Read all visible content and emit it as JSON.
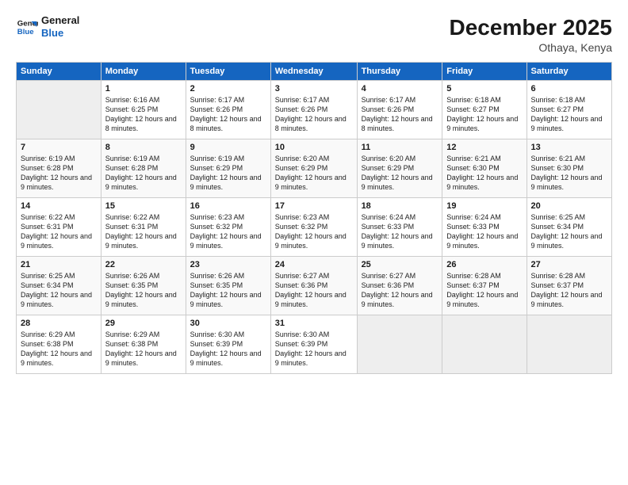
{
  "header": {
    "logo_line1": "General",
    "logo_line2": "Blue",
    "month_title": "December 2025",
    "location": "Othaya, Kenya"
  },
  "days_of_week": [
    "Sunday",
    "Monday",
    "Tuesday",
    "Wednesday",
    "Thursday",
    "Friday",
    "Saturday"
  ],
  "weeks": [
    [
      {
        "day": "",
        "sunrise": "",
        "sunset": "",
        "daylight": "",
        "empty": true
      },
      {
        "day": "1",
        "sunrise": "Sunrise: 6:16 AM",
        "sunset": "Sunset: 6:25 PM",
        "daylight": "Daylight: 12 hours and 8 minutes."
      },
      {
        "day": "2",
        "sunrise": "Sunrise: 6:17 AM",
        "sunset": "Sunset: 6:26 PM",
        "daylight": "Daylight: 12 hours and 8 minutes."
      },
      {
        "day": "3",
        "sunrise": "Sunrise: 6:17 AM",
        "sunset": "Sunset: 6:26 PM",
        "daylight": "Daylight: 12 hours and 8 minutes."
      },
      {
        "day": "4",
        "sunrise": "Sunrise: 6:17 AM",
        "sunset": "Sunset: 6:26 PM",
        "daylight": "Daylight: 12 hours and 8 minutes."
      },
      {
        "day": "5",
        "sunrise": "Sunrise: 6:18 AM",
        "sunset": "Sunset: 6:27 PM",
        "daylight": "Daylight: 12 hours and 9 minutes."
      },
      {
        "day": "6",
        "sunrise": "Sunrise: 6:18 AM",
        "sunset": "Sunset: 6:27 PM",
        "daylight": "Daylight: 12 hours and 9 minutes."
      }
    ],
    [
      {
        "day": "7",
        "sunrise": "Sunrise: 6:19 AM",
        "sunset": "Sunset: 6:28 PM",
        "daylight": "Daylight: 12 hours and 9 minutes."
      },
      {
        "day": "8",
        "sunrise": "Sunrise: 6:19 AM",
        "sunset": "Sunset: 6:28 PM",
        "daylight": "Daylight: 12 hours and 9 minutes."
      },
      {
        "day": "9",
        "sunrise": "Sunrise: 6:19 AM",
        "sunset": "Sunset: 6:29 PM",
        "daylight": "Daylight: 12 hours and 9 minutes."
      },
      {
        "day": "10",
        "sunrise": "Sunrise: 6:20 AM",
        "sunset": "Sunset: 6:29 PM",
        "daylight": "Daylight: 12 hours and 9 minutes."
      },
      {
        "day": "11",
        "sunrise": "Sunrise: 6:20 AM",
        "sunset": "Sunset: 6:29 PM",
        "daylight": "Daylight: 12 hours and 9 minutes."
      },
      {
        "day": "12",
        "sunrise": "Sunrise: 6:21 AM",
        "sunset": "Sunset: 6:30 PM",
        "daylight": "Daylight: 12 hours and 9 minutes."
      },
      {
        "day": "13",
        "sunrise": "Sunrise: 6:21 AM",
        "sunset": "Sunset: 6:30 PM",
        "daylight": "Daylight: 12 hours and 9 minutes."
      }
    ],
    [
      {
        "day": "14",
        "sunrise": "Sunrise: 6:22 AM",
        "sunset": "Sunset: 6:31 PM",
        "daylight": "Daylight: 12 hours and 9 minutes."
      },
      {
        "day": "15",
        "sunrise": "Sunrise: 6:22 AM",
        "sunset": "Sunset: 6:31 PM",
        "daylight": "Daylight: 12 hours and 9 minutes."
      },
      {
        "day": "16",
        "sunrise": "Sunrise: 6:23 AM",
        "sunset": "Sunset: 6:32 PM",
        "daylight": "Daylight: 12 hours and 9 minutes."
      },
      {
        "day": "17",
        "sunrise": "Sunrise: 6:23 AM",
        "sunset": "Sunset: 6:32 PM",
        "daylight": "Daylight: 12 hours and 9 minutes."
      },
      {
        "day": "18",
        "sunrise": "Sunrise: 6:24 AM",
        "sunset": "Sunset: 6:33 PM",
        "daylight": "Daylight: 12 hours and 9 minutes."
      },
      {
        "day": "19",
        "sunrise": "Sunrise: 6:24 AM",
        "sunset": "Sunset: 6:33 PM",
        "daylight": "Daylight: 12 hours and 9 minutes."
      },
      {
        "day": "20",
        "sunrise": "Sunrise: 6:25 AM",
        "sunset": "Sunset: 6:34 PM",
        "daylight": "Daylight: 12 hours and 9 minutes."
      }
    ],
    [
      {
        "day": "21",
        "sunrise": "Sunrise: 6:25 AM",
        "sunset": "Sunset: 6:34 PM",
        "daylight": "Daylight: 12 hours and 9 minutes."
      },
      {
        "day": "22",
        "sunrise": "Sunrise: 6:26 AM",
        "sunset": "Sunset: 6:35 PM",
        "daylight": "Daylight: 12 hours and 9 minutes."
      },
      {
        "day": "23",
        "sunrise": "Sunrise: 6:26 AM",
        "sunset": "Sunset: 6:35 PM",
        "daylight": "Daylight: 12 hours and 9 minutes."
      },
      {
        "day": "24",
        "sunrise": "Sunrise: 6:27 AM",
        "sunset": "Sunset: 6:36 PM",
        "daylight": "Daylight: 12 hours and 9 minutes."
      },
      {
        "day": "25",
        "sunrise": "Sunrise: 6:27 AM",
        "sunset": "Sunset: 6:36 PM",
        "daylight": "Daylight: 12 hours and 9 minutes."
      },
      {
        "day": "26",
        "sunrise": "Sunrise: 6:28 AM",
        "sunset": "Sunset: 6:37 PM",
        "daylight": "Daylight: 12 hours and 9 minutes."
      },
      {
        "day": "27",
        "sunrise": "Sunrise: 6:28 AM",
        "sunset": "Sunset: 6:37 PM",
        "daylight": "Daylight: 12 hours and 9 minutes."
      }
    ],
    [
      {
        "day": "28",
        "sunrise": "Sunrise: 6:29 AM",
        "sunset": "Sunset: 6:38 PM",
        "daylight": "Daylight: 12 hours and 9 minutes."
      },
      {
        "day": "29",
        "sunrise": "Sunrise: 6:29 AM",
        "sunset": "Sunset: 6:38 PM",
        "daylight": "Daylight: 12 hours and 9 minutes."
      },
      {
        "day": "30",
        "sunrise": "Sunrise: 6:30 AM",
        "sunset": "Sunset: 6:39 PM",
        "daylight": "Daylight: 12 hours and 9 minutes."
      },
      {
        "day": "31",
        "sunrise": "Sunrise: 6:30 AM",
        "sunset": "Sunset: 6:39 PM",
        "daylight": "Daylight: 12 hours and 9 minutes."
      },
      {
        "day": "",
        "sunrise": "",
        "sunset": "",
        "daylight": "",
        "empty": true
      },
      {
        "day": "",
        "sunrise": "",
        "sunset": "",
        "daylight": "",
        "empty": true
      },
      {
        "day": "",
        "sunrise": "",
        "sunset": "",
        "daylight": "",
        "empty": true
      }
    ]
  ]
}
